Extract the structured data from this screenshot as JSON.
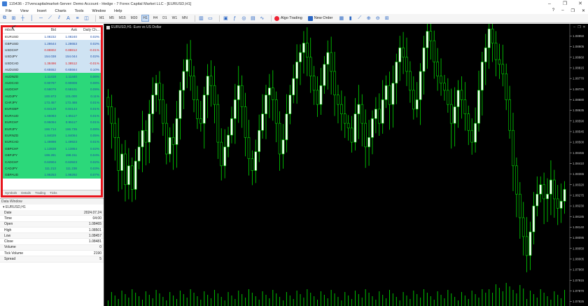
{
  "window": {
    "title": "115436 - 27vencapitalmarket-Server: Demo Account - Hedge - 7 Forex Capital Market LLC - [EURUSD,H1]",
    "controls": [
      "–",
      "❐",
      "✕"
    ]
  },
  "menu": {
    "items": [
      "File",
      "View",
      "Insert",
      "Charts",
      "Tools",
      "Window",
      "Help"
    ],
    "right": [
      "?",
      "–",
      "❐",
      "✕"
    ]
  },
  "toolbar": {
    "timeframes": [
      "M1",
      "M5",
      "M15",
      "M30",
      "H1",
      "H4",
      "D1",
      "W1",
      "MN"
    ],
    "active_timeframe": "H1",
    "algo_label": "Algo Trading",
    "order_label": "New Order"
  },
  "market_watch": {
    "headers": {
      "symbol": "mbol",
      "bid": "Bid",
      "ask": "Ask",
      "change": "Daily Ch..."
    },
    "rows": [
      {
        "symbol": "EURUSD",
        "bid": "1.08232",
        "ask": "1.08240",
        "change": "0.02%",
        "style": "white",
        "neg": false
      },
      {
        "symbol": "GBPUSD",
        "bid": "1.28644",
        "ask": "1.28653",
        "change": "0.02%",
        "style": "blue",
        "neg": false
      },
      {
        "symbol": "USDCHF",
        "bid": "0.88802",
        "ask": "0.88812",
        "change": "-0.01%",
        "style": "blue",
        "neg": true
      },
      {
        "symbol": "USDJPY",
        "bid": "154.038",
        "ask": "154.044",
        "change": "0.02%",
        "style": "blue",
        "neg": false
      },
      {
        "symbol": "USDCAD",
        "bid": "1.38496",
        "ask": "1.38512",
        "change": "-0.01%",
        "style": "blue",
        "neg": true
      },
      {
        "symbol": "AUDUSD",
        "bid": "0.65552",
        "ask": "0.65564",
        "change": "0.10%",
        "style": "blue",
        "neg": false
      },
      {
        "symbol": "AUDNZD",
        "bid": "1.11418",
        "ask": "1.11440",
        "change": "0.06%",
        "style": "green",
        "neg": false
      },
      {
        "symbol": "AUDCAD",
        "bid": "0.90787",
        "ask": "0.90808",
        "change": "0.08%",
        "style": "green",
        "neg": false
      },
      {
        "symbol": "AUDCHF",
        "bid": "0.58079",
        "ask": "0.58101",
        "change": "0.09%",
        "style": "green",
        "neg": false
      },
      {
        "symbol": "AUDJPY",
        "bid": "100.973",
        "ask": "101.000",
        "change": "0.11%",
        "style": "green",
        "neg": false
      },
      {
        "symbol": "CHFJPY",
        "bid": "173.457",
        "ask": "173.488",
        "change": "0.01%",
        "style": "green",
        "neg": false
      },
      {
        "symbol": "EURGBP",
        "bid": "0.84129",
        "ask": "0.84144",
        "change": "0.01%",
        "style": "green",
        "neg": false
      },
      {
        "symbol": "EURAUD",
        "bid": "1.65083",
        "ask": "1.65117",
        "change": "0.01%",
        "style": "green",
        "neg": false
      },
      {
        "symbol": "EURCHF",
        "bid": "0.95094",
        "ask": "0.95117",
        "change": "0.01%",
        "style": "green",
        "neg": false
      },
      {
        "symbol": "EURJPY",
        "bid": "166.714",
        "ask": "166.735",
        "change": "0.08%",
        "style": "green",
        "neg": false
      },
      {
        "symbol": "EURNZD",
        "bid": "1.84029",
        "ask": "1.84064",
        "change": "0.05%",
        "style": "green",
        "neg": false
      },
      {
        "symbol": "EURCAD",
        "bid": "1.49898",
        "ask": "1.49923",
        "change": "0.01%",
        "style": "green",
        "neg": false
      },
      {
        "symbol": "GBPCHF",
        "bid": "1.13838",
        "ask": "1.13864",
        "change": "0.02%",
        "style": "green",
        "neg": false
      },
      {
        "symbol": "GBPJPY",
        "bid": "198.281",
        "ask": "198.311",
        "change": "0.04%",
        "style": "green",
        "neg": false
      },
      {
        "symbol": "CADCHF",
        "bid": "0.63904",
        "ask": "0.63923",
        "change": "0.02%",
        "style": "green",
        "neg": false
      },
      {
        "symbol": "CADJPY",
        "bid": "111.213",
        "ask": "111.238",
        "change": "0.03%",
        "style": "green",
        "neg": false
      },
      {
        "symbol": "GBPAUD",
        "bid": "1.96253",
        "ask": "1.96292",
        "change": "0.07%",
        "style": "green",
        "neg": false
      }
    ],
    "tabs": [
      "Symbols",
      "Details",
      "Trading",
      "Ticks"
    ]
  },
  "data_window": {
    "title": "Data Window",
    "symbol": "EURUSD,H1",
    "rows": [
      {
        "label": "Date",
        "value": "2024.07.24"
      },
      {
        "label": "Time",
        "value": "04:00"
      },
      {
        "label": "Open",
        "value": "1.08465"
      },
      {
        "label": "High",
        "value": "1.08501"
      },
      {
        "label": "Low",
        "value": "1.08457"
      },
      {
        "label": "Close",
        "value": "1.08481"
      },
      {
        "label": "Volume",
        "value": "0"
      },
      {
        "label": "Tick Volume",
        "value": "2190"
      },
      {
        "label": "Spread",
        "value": "5"
      }
    ]
  },
  "chart": {
    "title": "EURUSD,H1: Euro vs US Dollar",
    "colors": {
      "bull": "#ffffff",
      "bear": "#000000",
      "wick": "#00e000",
      "volume": "#00c000"
    }
  },
  "chart_data": {
    "type": "candlestick",
    "title": "EURUSD,H1: Euro vs US Dollar",
    "y_ticks": [
      "1.08950",
      "1.08905",
      "1.08860",
      "1.08815",
      "1.08770",
      "1.08725",
      "1.08680",
      "1.08635",
      "1.08590",
      "1.08545",
      "1.08500",
      "1.08455",
      "1.08410",
      "1.08365",
      "1.08320",
      "1.08275",
      "1.08230",
      "1.08185",
      "1.08140",
      "1.08095",
      "1.08050",
      "1.08005",
      "1.07960",
      "1.07915",
      "1.07870",
      "1.07825"
    ],
    "ylim": [
      1.07806,
      1.08972
    ],
    "closes": [
      1.0865,
      1.0858,
      1.0852,
      1.0838,
      1.0845,
      1.0832,
      1.084,
      1.083,
      1.0842,
      1.0848,
      1.0855,
      1.085,
      1.0862,
      1.087,
      1.0875,
      1.0868,
      1.0858,
      1.0845,
      1.0852,
      1.0849,
      1.086,
      1.0872,
      1.088,
      1.0885,
      1.0878,
      1.0868,
      1.086,
      1.0858,
      1.087,
      1.0878,
      1.0874,
      1.0866,
      1.085,
      1.084,
      1.0848,
      1.0853,
      1.086,
      1.0868,
      1.0874,
      1.0865,
      1.0852,
      1.0843,
      1.0838,
      1.0846,
      1.0855,
      1.0862,
      1.087,
      1.0873,
      1.0868,
      1.0858,
      1.0845,
      1.0851,
      1.0862,
      1.087,
      1.0877,
      1.0884,
      1.0888,
      1.0892,
      1.0886,
      1.0878,
      1.0872,
      1.0866,
      1.0874,
      1.0883,
      1.0888,
      1.088,
      1.087,
      1.0866,
      1.0862,
      1.0858,
      1.0856,
      1.085,
      1.0862,
      1.0866,
      1.0858,
      1.0848,
      1.0852,
      1.086,
      1.0864,
      1.0858,
      1.0868,
      1.0874,
      1.0866,
      1.0875,
      1.0884,
      1.089,
      1.0886,
      1.088,
      1.0872,
      1.0864,
      1.0868,
      1.088,
      1.089,
      1.0897,
      1.0893,
      1.0884,
      1.0878,
      1.0875,
      1.0872,
      1.0866,
      1.0858,
      1.0865,
      1.0872,
      1.0868,
      1.0862,
      1.0855,
      1.085,
      1.0858,
      1.0872,
      1.0884,
      1.089,
      1.0898,
      1.0892,
      1.0885,
      1.0883,
      1.0879,
      1.0868,
      1.0855,
      1.084,
      1.0828,
      1.0818,
      1.081,
      1.0802,
      1.0812,
      1.0823,
      1.0828,
      1.0832,
      1.0826,
      1.0828,
      1.0834,
      1.0826,
      1.0822,
      1.0825,
      1.083
    ]
  }
}
